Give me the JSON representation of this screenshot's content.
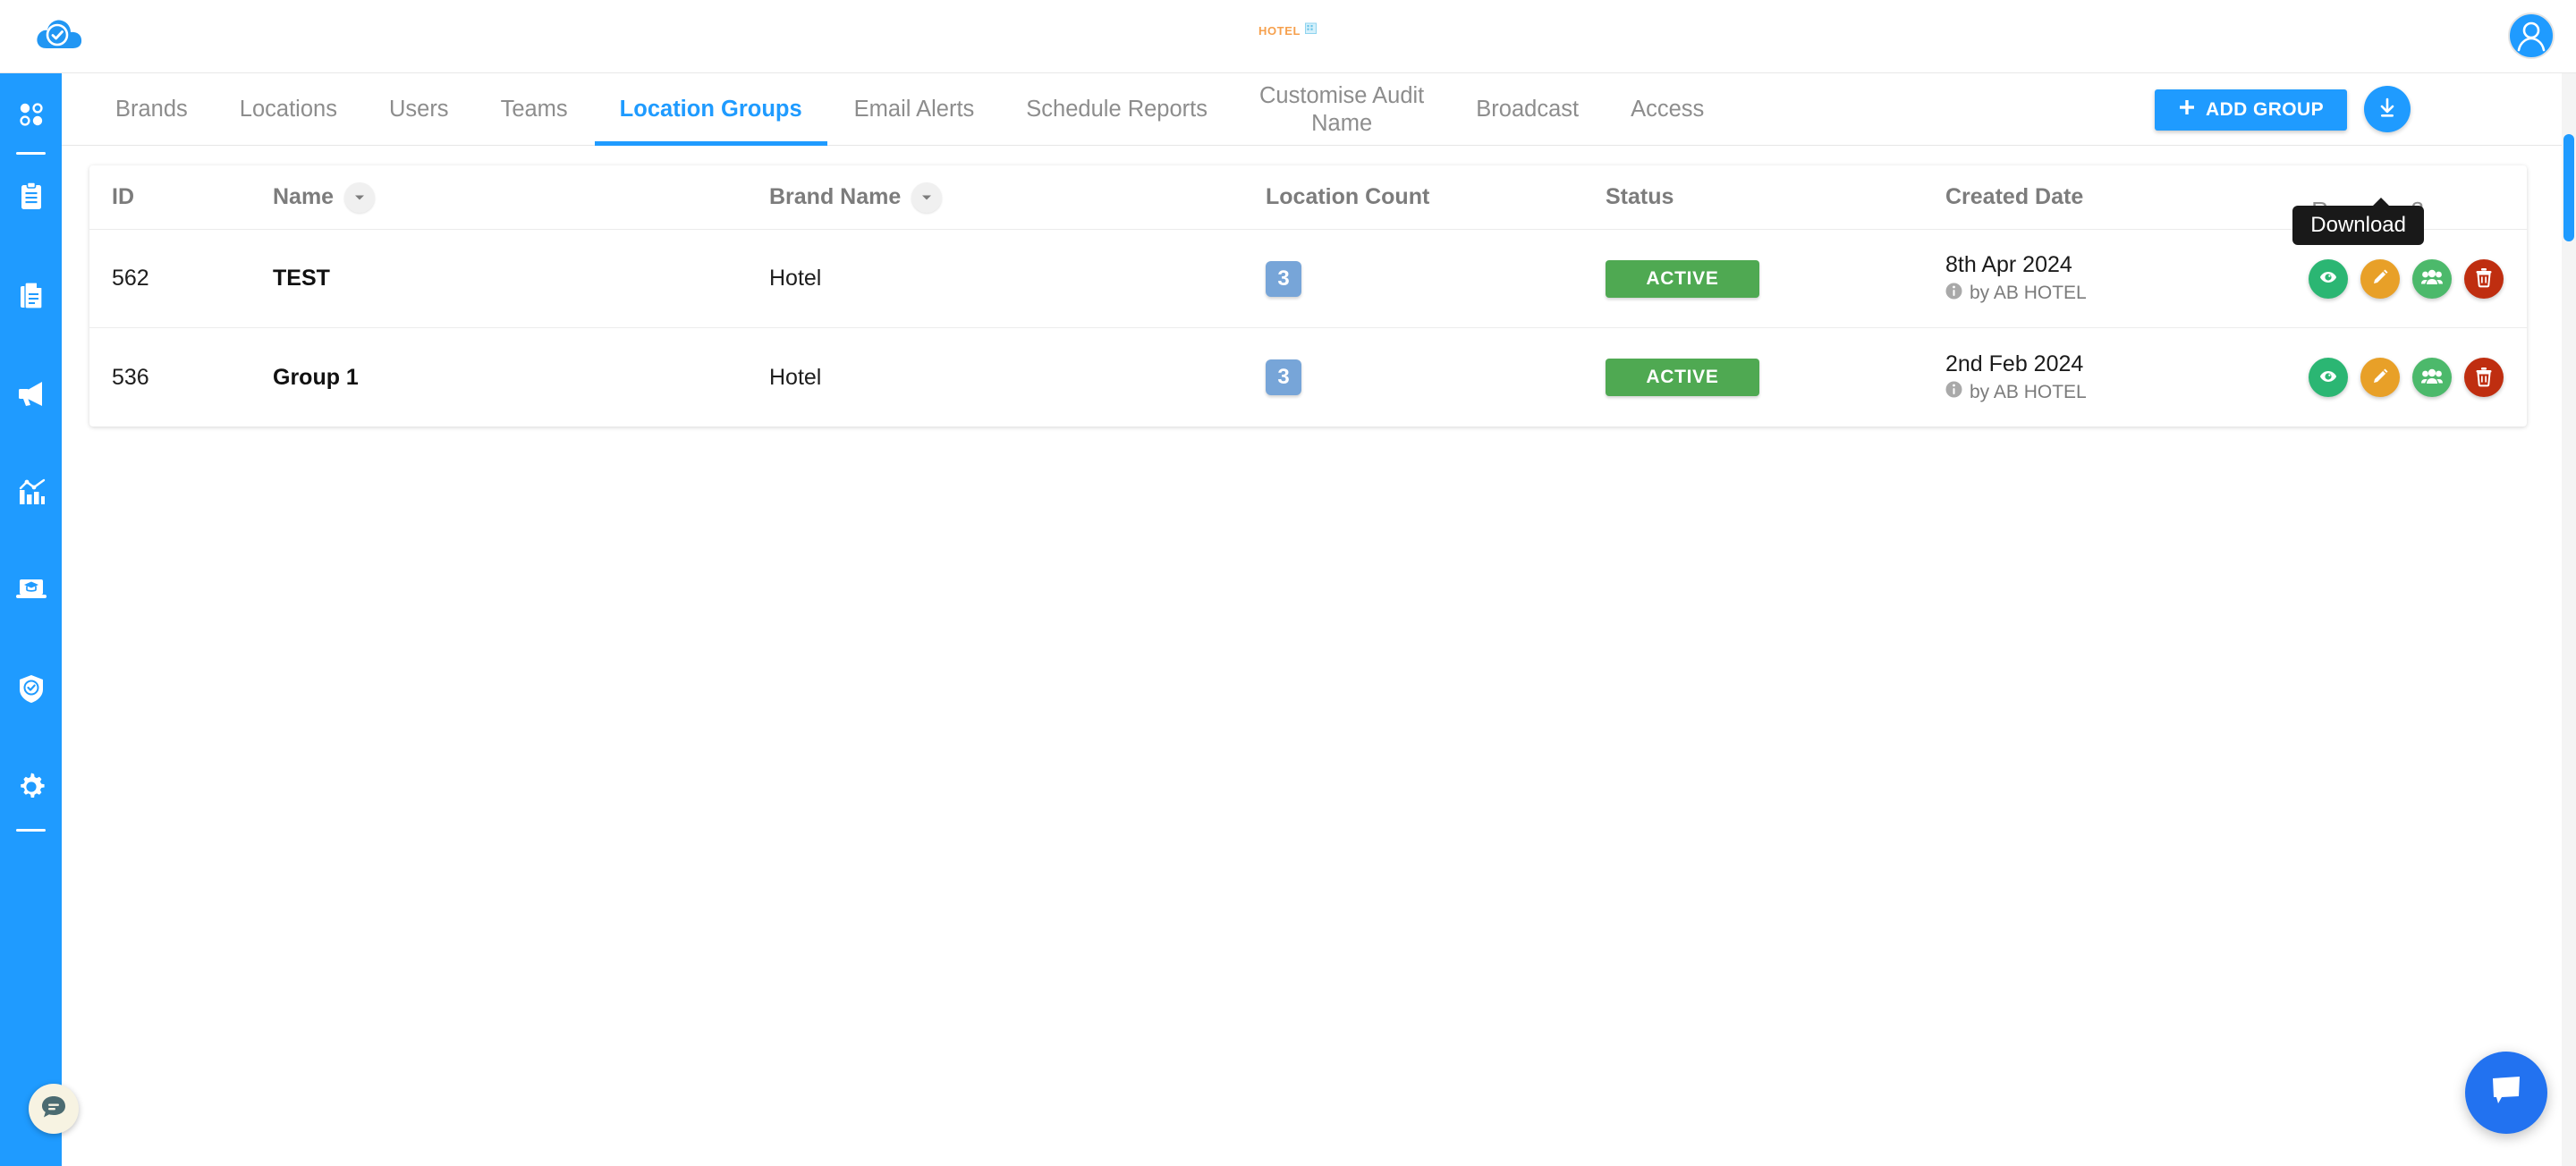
{
  "header": {
    "logo_icon": "cloud-check-icon",
    "center_logo_text": "HOTEL",
    "center_logo_icon": "building-icon",
    "avatar_icon": "user-avatar-icon"
  },
  "sidebar": {
    "items": [
      {
        "icon": "dashboard-dots-icon",
        "name": "dashboard"
      },
      {
        "icon": "clipboard-icon",
        "name": "audits"
      },
      {
        "icon": "document-icon",
        "name": "reports"
      },
      {
        "icon": "megaphone-icon",
        "name": "broadcast"
      },
      {
        "icon": "chart-bar-icon",
        "name": "analytics"
      },
      {
        "icon": "training-laptop-icon",
        "name": "training"
      },
      {
        "icon": "shield-check-icon",
        "name": "compliance"
      },
      {
        "icon": "gear-icon",
        "name": "settings"
      }
    ],
    "chat_icon": "chat-bubble-icon"
  },
  "tabs": [
    {
      "label": "Brands",
      "active": false
    },
    {
      "label": "Locations",
      "active": false
    },
    {
      "label": "Users",
      "active": false
    },
    {
      "label": "Teams",
      "active": false
    },
    {
      "label": "Location Groups",
      "active": true
    },
    {
      "label": "Email Alerts",
      "active": false
    },
    {
      "label": "Schedule Reports",
      "active": false
    },
    {
      "label": "Customise Audit\nName",
      "active": false
    },
    {
      "label": "Broadcast",
      "active": false
    },
    {
      "label": "Access",
      "active": false
    }
  ],
  "toolbar": {
    "add_group_label": "ADD GROUP",
    "add_group_icon": "plus-icon",
    "download_icon": "download-icon",
    "download_tooltip": "Download",
    "records_text": "Records: 2"
  },
  "table": {
    "columns": [
      {
        "label": "ID",
        "filter": false
      },
      {
        "label": "Name",
        "filter": true
      },
      {
        "label": "Brand Name",
        "filter": true
      },
      {
        "label": "Location Count",
        "filter": false
      },
      {
        "label": "Status",
        "filter": false
      },
      {
        "label": "Created Date",
        "filter": false
      }
    ],
    "rows": [
      {
        "id": "562",
        "name": "TEST",
        "brand_name": "Hotel",
        "location_count": "3",
        "status": "ACTIVE",
        "created_date": "8th Apr 2024",
        "created_by": "by AB HOTEL"
      },
      {
        "id": "536",
        "name": "Group 1",
        "brand_name": "Hotel",
        "location_count": "3",
        "status": "ACTIVE",
        "created_date": "2nd Feb 2024",
        "created_by": "by AB HOTEL"
      }
    ],
    "row_actions": [
      {
        "name": "view",
        "icon": "eye-icon"
      },
      {
        "name": "edit",
        "icon": "pencil-icon"
      },
      {
        "name": "manage-users",
        "icon": "users-group-icon"
      },
      {
        "name": "delete",
        "icon": "trash-icon"
      }
    ]
  },
  "chat_widget": {
    "icon": "chat-bubble-icon"
  },
  "colors": {
    "primary": "#1f9bff",
    "active_tab": "#1f9bff",
    "status_active": "#4fa952",
    "count_badge": "#77a5d8",
    "action_view": "#2bb673",
    "action_edit": "#e8a028",
    "action_users": "#4cb96b",
    "action_delete": "#bf2e10",
    "logo_orange": "#f6a04d",
    "chat_blue": "#2272f0"
  }
}
